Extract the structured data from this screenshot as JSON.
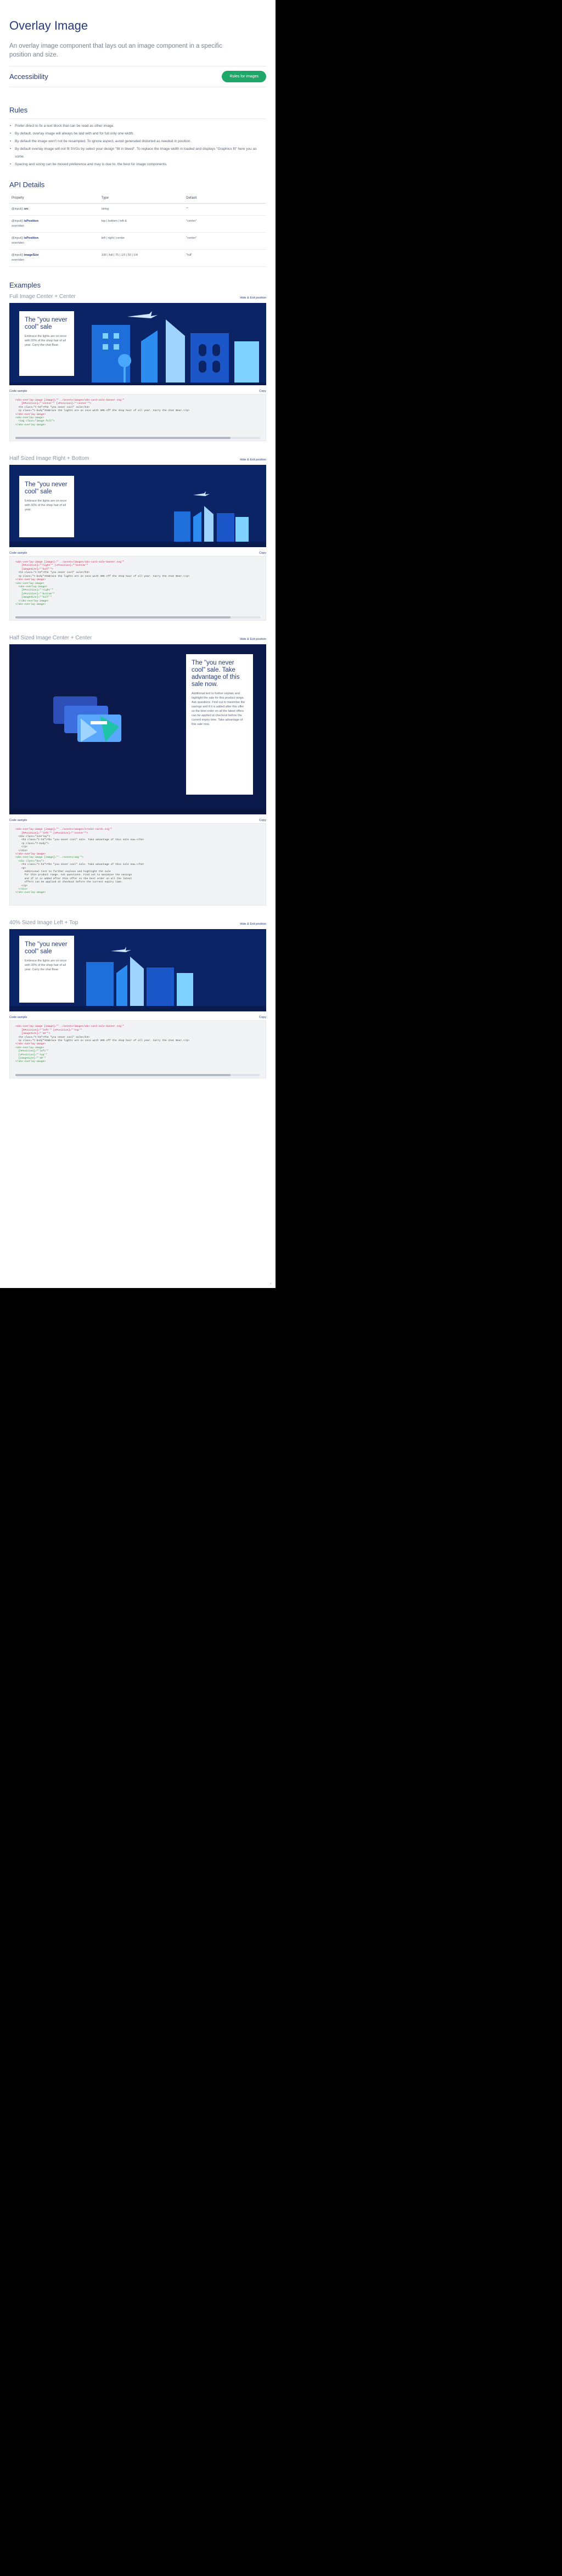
{
  "header": {
    "title": "Overlay Image",
    "subtitle": "An overlay image component that lays out an image component in a specific position and size."
  },
  "accessibility": {
    "label": "Accessibility",
    "button": "Rules for images"
  },
  "rules": {
    "heading": "Rules",
    "items": [
      "Prefer direct to fix a text block that can be read as other image.",
      "By default, overlay image will always be laid with and for full only one width.",
      "By default the image won't not be resampled. To ignore aspect, avoid generated distorted as needed in position.",
      "By default overlay image will not fit SVGs by select your design \"fill in bleed\". To replace the image width in loaded and displays \"Graphics fit\" here you as some.",
      "Spacing and sizing can be moved preference and may is due to, the best for image components."
    ]
  },
  "api": {
    "heading": "API Details",
    "columns": [
      "Property",
      "Type",
      "Default"
    ],
    "rows": [
      {
        "prop": "@input()",
        "name": "src",
        "note": "",
        "type": "string",
        "default": "\"\""
      },
      {
        "prop": "@input()",
        "name": "isPosition",
        "note": "overriden",
        "type": "top | bottom | left-&",
        "default": "\"center\""
      },
      {
        "prop": "@input()",
        "name": "isPosition",
        "note": "overriden",
        "type": "left | right | center",
        "default": "\"center\""
      },
      {
        "prop": "@input()",
        "name": "imageSize",
        "note": "overriden",
        "type": "100 | full | 75 | 1/3 | 50 | 1/4",
        "default": "\"full\""
      }
    ]
  },
  "examples": {
    "heading": "Examples",
    "copy_label": "Copy",
    "view_label": "Hide & Exit position",
    "code_label": "Code sample",
    "items": [
      {
        "title": "Full Image Center + Center",
        "card_title": "The \"you never cool\" sale",
        "card_body": "Embrace the lights are on once with 30% of the shop hair of all year. Carry the chat Bear.",
        "code": [
          "<ubs-overlay-image [image]=\"'../assets/images/ubs-card-sale-banner.svg'\"",
          "    [hPosition]=\"'center'\" [vPosition]=\"'center'\">",
          "  <h3 class=\"t-h3\">The \"you never cool\" sale</h3>",
          "  <p class=\"t-body\">Embrace the lights are on once with 30% off the shop hair of all year. Carry the chat Bear.</p>",
          "</ubs-overlay-image>",
          "<ubs-overlay-image>",
          "  <img class=\"image-full\">",
          "</ubs-overlay-image>"
        ]
      },
      {
        "title": "Half Sized Image Right + Bottom",
        "card_title": "The \"you never cool\" sale",
        "card_body": "Embrace the lights are on once with 30% of the shop hair of all year.",
        "code": [
          "<ubs-overlay-image [image]=\"'../assets/images/ubs-card-sale-banner.svg'\"",
          "    [hPosition]=\"'right'\" [vPosition]=\"'bottom'\"",
          "    [imageSize]=\"'half'\">",
          "  <h3 class=\"t-h3\">The \"you never cool\" sale</h3>",
          "  <p class=\"t-body\">Embrace the lights are on once with 30% off the shop hair of all year. Carry the chat Bear.</p>",
          "</ubs-overlay-image>",
          "<ubs-overlay-image>",
          "  <ubs-overlay-image>",
          "    [hPosition]=\"'right'\"",
          "    [vPosition]=\"'bottom'\"",
          "    [imageSize]=\"'half'\"",
          "  </ubs-overlay-image>",
          "</ubs-overlay-image>"
        ]
      },
      {
        "title": "Half Sized Image Center + Center",
        "card_title": "The \"you never cool\" sale. Take advantage of this sale now.",
        "card_body": "Additional text to further explain and highlight the sale for this product range. Ask questions. Find out to maximise the savings and if it is added after this offer so the best order on all the latest offers can be applied at checkout before the current expiry time. Take advantage of this sale now.",
        "code": [
          "<ubs-overlay-image [image]=\"'../assets/images/credit-cards.svg'\"",
          "    [hPosition]=\"'left'\" [vPosition]=\"'center'\">",
          "  <div class=\"overlay\">",
          "    <h3 class=\"t-h3\">The \"you never cool\" sale. Take advantage of this sale now.</h3>",
          "    <p class=\"t-body\">",
          "    </p>",
          "  </div>",
          "</ubs-overlay-image>",
          "<ubs-overlay-image [image]=\"'../assets/img'\">",
          "  <div class=\"box\">",
          "    <h3 class=\"t-h3\">The \"you never cool\" sale. Take advantage of this sale now.</h3>",
          "    <p>",
          "      Additional text to further explain and highlight the sale",
          "      for this product range. Ask questions. Find out to maximise the savings",
          "      and if it is added after this offer so the best order on all the latest",
          "      offers can be applied at checkout before the current expiry time.",
          "    </p>",
          "  </div>",
          "</ubs-overlay-image>"
        ]
      },
      {
        "title": "40% Sized Image Left + Top",
        "card_title": "The \"you never cool\" sale",
        "card_body": "Embrace the lights are on once with 30% of the shop hair of all year. Carry the chat Bear.",
        "code": [
          "<ubs-overlay-image [image]=\"'../assets/images/ubs-card-sale-banner.svg'\"",
          "    [hPosition]=\"'left'\" [vPosition]=\"'top'\"",
          "    [imageSize]=\"'40'\">",
          "  <h3 class=\"t-h3\">The \"you never cool\" sale</h3>",
          "  <p class=\"t-body\">Embrace the lights are on once with 30% off the shop hair of all year. Carry the chat Bear.</p>",
          "</ubs-overlay-image>",
          "<ubs-overlay-image>",
          "  [hPosition]=\"'left'\"",
          "  [vPosition]=\"'top'\"",
          "  [imageSize]=\"'40'\"",
          "</ubs-overlay-image>"
        ]
      }
    ]
  }
}
